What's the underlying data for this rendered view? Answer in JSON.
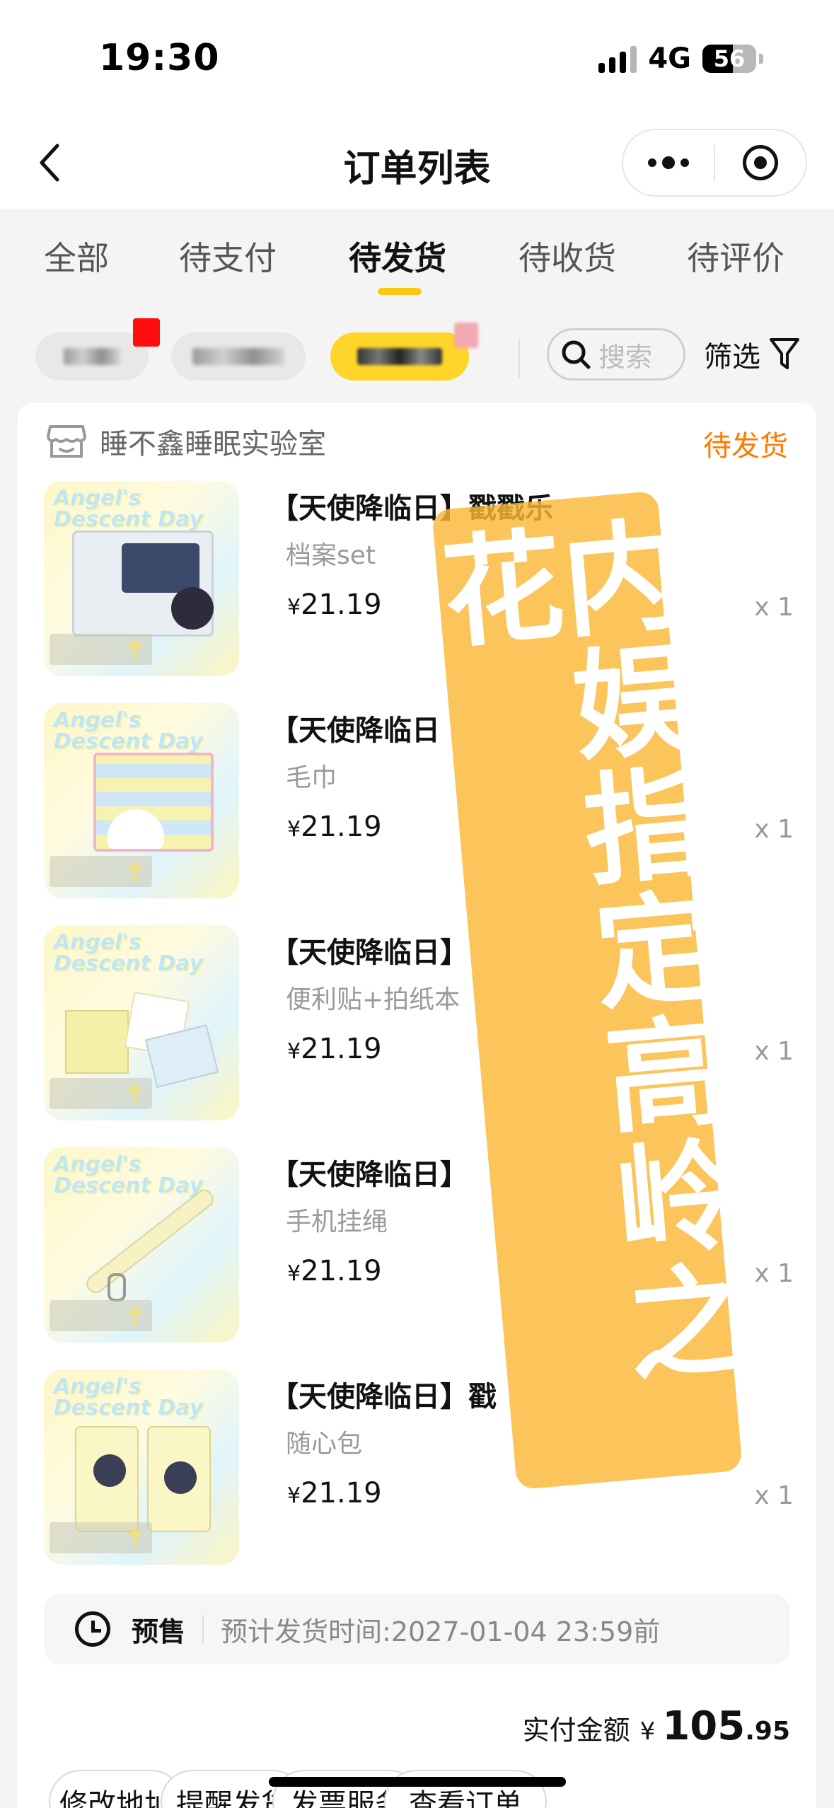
{
  "status_bar": {
    "time": "19:30",
    "network": "4G",
    "battery": "56"
  },
  "nav": {
    "title": "订单列表"
  },
  "tabs": [
    {
      "label": "全部"
    },
    {
      "label": "待支付"
    },
    {
      "label": "待发货",
      "active": true
    },
    {
      "label": "待收货"
    },
    {
      "label": "待评价"
    }
  ],
  "search": {
    "placeholder": "搜索"
  },
  "filter": {
    "label": "筛选"
  },
  "order": {
    "shop_name": "睡不鑫睡眠实验室",
    "status": "待发货",
    "accent_color": "#ff7a00",
    "items": [
      {
        "title": "【天使降临日】戳戳乐",
        "subtitle": "档案set",
        "currency": "¥",
        "price": "21.19",
        "qty": "x 1",
        "thumb_brand": "Angel's Descent Day"
      },
      {
        "title": "【天使降临日",
        "subtitle": "毛巾",
        "currency": "¥",
        "price": "21.19",
        "qty": "x 1",
        "thumb_brand": "Angel's Descent Day"
      },
      {
        "title": "【天使降临日】",
        "subtitle": "便利贴+拍纸本",
        "currency": "¥",
        "price": "21.19",
        "qty": "x 1",
        "thumb_brand": "Angel's Descent Day"
      },
      {
        "title": "【天使降临日】",
        "subtitle": "手机挂绳",
        "currency": "¥",
        "price": "21.19",
        "qty": "x 1",
        "thumb_brand": "Angel's Descent Day"
      },
      {
        "title": "【天使降临日】戳",
        "subtitle": "随心包",
        "currency": "¥",
        "price": "21.19",
        "qty": "x 1",
        "thumb_brand": "Angel's Descent Day"
      }
    ],
    "presale": {
      "label": "预售",
      "text": "预计发货时间:2027-01-04 23:59前"
    },
    "total": {
      "label": "实付金额",
      "currency": "¥",
      "integer": "105",
      "decimal": ".95"
    },
    "actions": [
      "修改地址",
      "提醒发货",
      "发票服务",
      "查看订单"
    ]
  },
  "watermark": {
    "text": "内娱指定高岭之花",
    "color": "#fab837"
  },
  "theme": {
    "tab_indicator": "#ffc61a",
    "active_chip": "#ffd52a"
  }
}
